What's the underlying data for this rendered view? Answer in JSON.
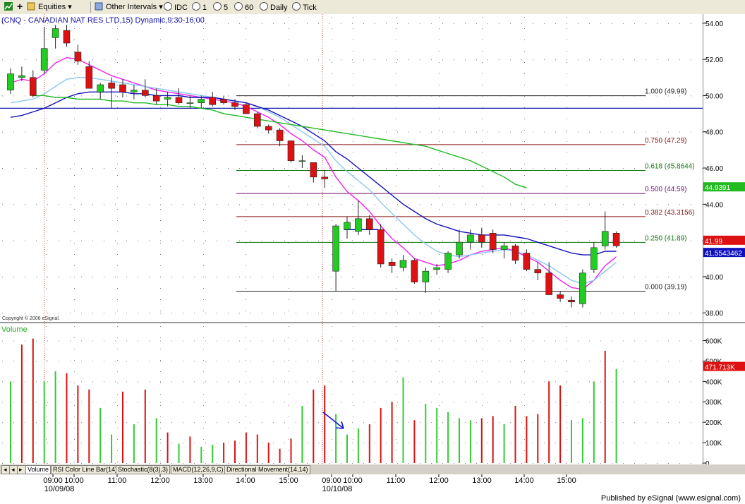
{
  "toolbar": {
    "plus": "+",
    "equities": "Equities",
    "other_intervals": "Other Intervals",
    "idc": "IDC",
    "i1": "1",
    "i5": "5",
    "i60": "60",
    "daily": "Daily",
    "tick": "Tick"
  },
  "chart_title": "(CNQ - CANADIAN NAT RES LTD,15) Dynamic,9:30-16:00",
  "copyright": "Copyright © 2006 eSignal.",
  "volume_label": "Volume",
  "footer_text": "Published by eSignal (www.esignal.com)",
  "tabs": [
    "Volume",
    "RSI Color Line Bar(14)",
    "Stochastic(8(3),3)",
    "MACD(12,26,9,C)",
    "Directional Movement(14,14)"
  ],
  "time_labels": [
    "09:00",
    "10:00",
    "11:00",
    "12:00",
    "13:00",
    "14:00",
    "15:00",
    "09:00",
    "10:00",
    "11:00",
    "12:00",
    "13:00",
    "14:00",
    "15:00"
  ],
  "date_labels": [
    "10/09/08",
    "10/10/08"
  ],
  "price_ticks": [
    "54.00",
    "52.00",
    "50.00",
    "48.00",
    "46.00",
    "44.00",
    "42.00",
    "40.00",
    "38.00"
  ],
  "vol_ticks": [
    "600K",
    "500K",
    "400K",
    "300K",
    "200K",
    "100K",
    "0"
  ],
  "price_badges": [
    "44.9391",
    "41.99",
    "41.5543462"
  ],
  "vol_badge": "471.713K",
  "colors": {
    "up": "#22cc22",
    "down": "#dd1111",
    "ema_fast": "#ee22ee",
    "ema_mid": "#88c8ee",
    "sma_blue": "#1111bb",
    "sma_green": "#22bb22",
    "hline": "#1122aa"
  },
  "chart_data": {
    "type": "candlestick",
    "title": "(CNQ - CANADIAN NAT RES LTD,15) Dynamic,9:30-16:00",
    "ylim": [
      37.5,
      54.5
    ],
    "y_ticks": [
      54,
      52,
      50,
      48,
      46,
      44,
      42,
      40,
      38
    ],
    "horizontal_line": 49.3,
    "candles": [
      {
        "o": 50.3,
        "h": 51.5,
        "l": 50.1,
        "c": 51.2
      },
      {
        "o": 51.0,
        "h": 51.6,
        "l": 50.8,
        "c": 51.1
      },
      {
        "o": 51.0,
        "h": 51.4,
        "l": 49.9,
        "c": 50.0
      },
      {
        "o": 51.4,
        "h": 53.8,
        "l": 51.2,
        "c": 52.6
      },
      {
        "o": 53.2,
        "h": 53.9,
        "l": 52.6,
        "c": 53.7
      },
      {
        "o": 53.6,
        "h": 53.9,
        "l": 52.7,
        "c": 52.9
      },
      {
        "o": 52.4,
        "h": 52.8,
        "l": 51.7,
        "c": 51.9
      },
      {
        "o": 51.6,
        "h": 51.9,
        "l": 50.4,
        "c": 50.4
      },
      {
        "o": 50.2,
        "h": 50.7,
        "l": 49.8,
        "c": 50.6
      },
      {
        "o": 50.7,
        "h": 51.0,
        "l": 49.3,
        "c": 50.4
      },
      {
        "o": 50.6,
        "h": 50.9,
        "l": 49.9,
        "c": 50.2
      },
      {
        "o": 50.2,
        "h": 50.6,
        "l": 49.8,
        "c": 50.3
      },
      {
        "o": 50.3,
        "h": 50.9,
        "l": 49.9,
        "c": 50.0
      },
      {
        "o": 50.0,
        "h": 50.4,
        "l": 49.5,
        "c": 49.7
      },
      {
        "o": 49.8,
        "h": 50.2,
        "l": 49.4,
        "c": 49.9
      },
      {
        "o": 49.9,
        "h": 50.4,
        "l": 49.5,
        "c": 49.6
      },
      {
        "o": 49.6,
        "h": 50.0,
        "l": 49.3,
        "c": 49.6
      },
      {
        "o": 49.6,
        "h": 50.0,
        "l": 49.3,
        "c": 49.8
      },
      {
        "o": 49.9,
        "h": 50.2,
        "l": 49.4,
        "c": 49.5
      },
      {
        "o": 49.8,
        "h": 50.0,
        "l": 49.5,
        "c": 49.6
      },
      {
        "o": 49.6,
        "h": 49.8,
        "l": 49.2,
        "c": 49.4
      },
      {
        "o": 49.5,
        "h": 49.6,
        "l": 49.0,
        "c": 49.0
      },
      {
        "o": 49.0,
        "h": 49.1,
        "l": 48.2,
        "c": 48.3
      },
      {
        "o": 48.3,
        "h": 48.4,
        "l": 47.9,
        "c": 48.1
      },
      {
        "o": 48.1,
        "h": 48.2,
        "l": 47.2,
        "c": 47.5
      },
      {
        "o": 47.5,
        "h": 47.5,
        "l": 46.3,
        "c": 46.4
      },
      {
        "o": 46.4,
        "h": 46.7,
        "l": 46.0,
        "c": 46.4
      },
      {
        "o": 46.3,
        "h": 46.3,
        "l": 45.2,
        "c": 45.5
      },
      {
        "o": 45.5,
        "h": 45.9,
        "l": 44.9,
        "c": 45.4
      },
      {
        "o": 40.3,
        "h": 42.9,
        "l": 39.2,
        "c": 42.8
      },
      {
        "o": 42.6,
        "h": 43.3,
        "l": 42.1,
        "c": 43.0
      },
      {
        "o": 42.5,
        "h": 44.2,
        "l": 42.3,
        "c": 43.2
      },
      {
        "o": 43.2,
        "h": 43.4,
        "l": 42.3,
        "c": 42.6
      },
      {
        "o": 42.6,
        "h": 42.9,
        "l": 40.5,
        "c": 40.7
      },
      {
        "o": 40.8,
        "h": 41.0,
        "l": 40.2,
        "c": 40.6
      },
      {
        "o": 40.5,
        "h": 41.2,
        "l": 40.3,
        "c": 40.9
      },
      {
        "o": 40.9,
        "h": 41.0,
        "l": 39.6,
        "c": 39.7
      },
      {
        "o": 39.7,
        "h": 40.5,
        "l": 39.1,
        "c": 40.3
      },
      {
        "o": 40.4,
        "h": 40.7,
        "l": 40.1,
        "c": 40.5
      },
      {
        "o": 40.4,
        "h": 41.4,
        "l": 40.2,
        "c": 41.3
      },
      {
        "o": 41.2,
        "h": 42.6,
        "l": 41.0,
        "c": 41.9
      },
      {
        "o": 41.9,
        "h": 42.6,
        "l": 41.5,
        "c": 42.3
      },
      {
        "o": 42.3,
        "h": 42.7,
        "l": 41.6,
        "c": 41.9
      },
      {
        "o": 42.4,
        "h": 42.6,
        "l": 41.3,
        "c": 41.5
      },
      {
        "o": 41.5,
        "h": 41.9,
        "l": 41.0,
        "c": 41.7
      },
      {
        "o": 41.7,
        "h": 41.8,
        "l": 40.7,
        "c": 40.9
      },
      {
        "o": 41.3,
        "h": 41.5,
        "l": 40.3,
        "c": 40.4
      },
      {
        "o": 40.4,
        "h": 40.8,
        "l": 39.8,
        "c": 40.2
      },
      {
        "o": 40.2,
        "h": 40.8,
        "l": 39.0,
        "c": 39.0
      },
      {
        "o": 39.0,
        "h": 39.2,
        "l": 38.6,
        "c": 38.8
      },
      {
        "o": 38.7,
        "h": 38.9,
        "l": 38.3,
        "c": 38.6
      },
      {
        "o": 38.5,
        "h": 40.4,
        "l": 38.3,
        "c": 40.2
      },
      {
        "o": 40.4,
        "h": 41.9,
        "l": 40.2,
        "c": 41.6
      },
      {
        "o": 41.7,
        "h": 43.6,
        "l": 41.5,
        "c": 42.5
      },
      {
        "o": 42.4,
        "h": 42.5,
        "l": 41.6,
        "c": 41.7
      }
    ],
    "volume": {
      "ylim": [
        0,
        650000
      ],
      "ticks": [
        600000,
        500000,
        400000,
        300000,
        200000,
        100000,
        0
      ],
      "values": [
        400000,
        580000,
        610000,
        400000,
        450000,
        440000,
        380000,
        360000,
        270000,
        140000,
        350000,
        190000,
        360000,
        220000,
        150000,
        95000,
        130000,
        80000,
        90000,
        100000,
        110000,
        150000,
        140000,
        100000,
        70000,
        120000,
        280000,
        360000,
        380000,
        240000,
        140000,
        170000,
        190000,
        270000,
        300000,
        420000,
        210000,
        290000,
        270000,
        250000,
        220000,
        210000,
        220000,
        230000,
        190000,
        280000,
        230000,
        240000,
        400000,
        380000,
        210000,
        220000,
        400000,
        550000,
        460000
      ],
      "up": [
        true,
        false,
        false,
        true,
        true,
        false,
        false,
        false,
        true,
        true,
        false,
        true,
        false,
        true,
        false,
        true,
        false,
        true,
        true,
        false,
        false,
        false,
        false,
        false,
        false,
        false,
        true,
        false,
        false,
        true,
        true,
        true,
        false,
        false,
        false,
        true,
        false,
        true,
        true,
        true,
        true,
        true,
        false,
        false,
        true,
        false,
        false,
        false,
        false,
        false,
        true,
        true,
        true,
        false
      ]
    },
    "moving_averages": [
      {
        "color": "#ee22ee",
        "values": [
          50.7,
          50.9,
          50.8,
          51.2,
          51.8,
          52.1,
          52.0,
          51.7,
          51.4,
          51.1,
          50.9,
          50.7,
          50.5,
          50.3,
          50.2,
          50.1,
          50.0,
          49.9,
          49.8,
          49.7,
          49.6,
          49.4,
          49.1,
          48.8,
          48.4,
          47.9,
          47.5,
          47.0,
          46.6,
          45.5,
          44.7,
          44.2,
          43.6,
          42.8,
          42.1,
          41.6,
          41.0,
          40.8,
          40.6,
          40.7,
          40.9,
          41.2,
          41.4,
          41.5,
          41.6,
          41.4,
          41.1,
          40.8,
          40.3,
          39.8,
          39.4,
          39.3,
          39.8,
          40.6,
          41.1
        ]
      },
      {
        "color": "#88c8ee",
        "values": [
          49.6,
          49.7,
          49.8,
          50.1,
          50.5,
          50.9,
          51.0,
          51.0,
          50.9,
          50.8,
          50.7,
          50.6,
          50.5,
          50.4,
          50.3,
          50.2,
          50.1,
          50.0,
          49.9,
          49.8,
          49.7,
          49.6,
          49.4,
          49.1,
          48.8,
          48.4,
          48.0,
          47.6,
          47.2,
          46.4,
          45.8,
          45.3,
          44.8,
          44.1,
          43.5,
          42.9,
          42.3,
          41.8,
          41.4,
          41.2,
          41.1,
          41.2,
          41.3,
          41.4,
          41.5,
          41.4,
          41.2,
          40.9,
          40.6,
          40.2,
          39.8,
          39.6,
          39.8,
          40.3,
          40.8
        ]
      },
      {
        "color": "#1111bb",
        "values": [
          48.8,
          48.9,
          49.1,
          49.3,
          49.6,
          49.9,
          50.1,
          50.2,
          50.2,
          50.2,
          50.2,
          50.1,
          50.1,
          50.0,
          50.0,
          50.0,
          49.9,
          49.9,
          49.9,
          49.8,
          49.7,
          49.6,
          49.4,
          49.2,
          48.9,
          48.6,
          48.3,
          47.9,
          47.5,
          46.9,
          46.5,
          46.0,
          45.5,
          45.0,
          44.5,
          44.0,
          43.6,
          43.2,
          42.9,
          42.7,
          42.5,
          42.4,
          42.3,
          42.3,
          42.3,
          42.2,
          42.1,
          41.9,
          41.7,
          41.5,
          41.3,
          41.2,
          41.2,
          41.4,
          41.4
        ]
      },
      {
        "color": "#22bb22",
        "start": 2,
        "values": [
          50.0,
          50.0,
          49.9,
          49.9,
          49.8,
          49.8,
          49.8,
          49.7,
          49.7,
          49.6,
          49.6,
          49.5,
          49.5,
          49.4,
          49.4,
          49.3,
          49.2,
          49.0,
          48.9,
          48.8,
          48.7,
          48.6,
          48.5,
          48.4,
          48.3,
          48.2,
          48.1,
          48.0,
          47.9,
          47.8,
          47.7,
          47.6,
          47.5,
          47.4,
          47.3,
          47.2,
          47.0,
          46.8,
          46.6,
          46.4,
          46.1,
          45.8,
          45.5,
          45.1,
          44.9
        ]
      }
    ],
    "fib_levels": [
      {
        "label": "1.000 (49.99)",
        "value": 49.99,
        "color": "#222222"
      },
      {
        "label": "0.750 (47.29)",
        "value": 47.29,
        "color": "#881111"
      },
      {
        "label": "0.618 (45.8644)",
        "value": 45.8644,
        "color": "#117711"
      },
      {
        "label": "0.500 (44.59)",
        "value": 44.59,
        "color": "#771177"
      },
      {
        "label": "0.382 (43.3156)",
        "value": 43.3156,
        "color": "#881111"
      },
      {
        "label": "0.250 (41.89)",
        "value": 41.89,
        "color": "#117711"
      },
      {
        "label": "0.000 (39.19)",
        "value": 39.19,
        "color": "#222222"
      }
    ]
  }
}
